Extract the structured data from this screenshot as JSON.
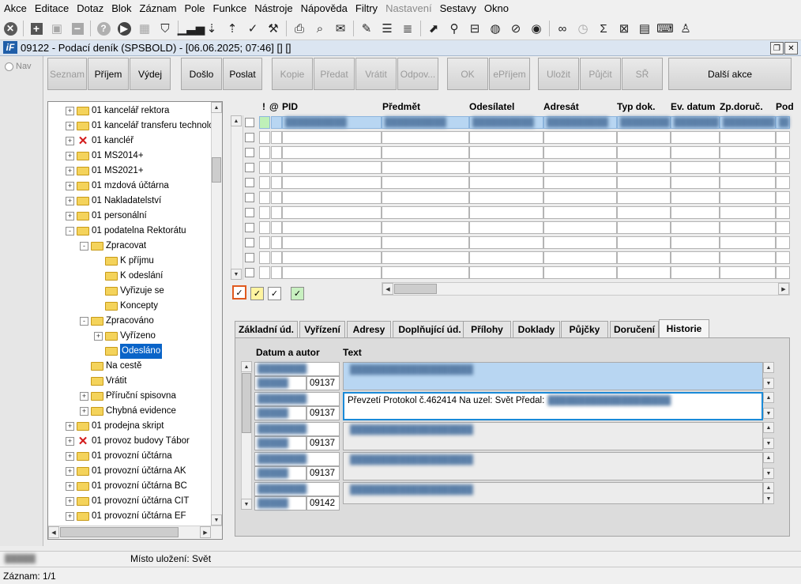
{
  "menu": [
    "Akce",
    "Editace",
    "Dotaz",
    "Blok",
    "Záznam",
    "Pole",
    "Funkce",
    "Nástroje",
    "Nápověda",
    "Filtry",
    "Nastavení",
    "Sestavy",
    "Okno"
  ],
  "menu_disabled_index": 10,
  "window": {
    "logo": "iF",
    "title": "09122 - Podací deník (SPSBOLD) - [06.06.2025; 07:46] [] []"
  },
  "nav": {
    "label": "Nav"
  },
  "actions": {
    "seznam": "Seznam",
    "prijem": "Příjem",
    "vydej": "Výdej",
    "doslo": "Došlo",
    "poslat": "Poslat",
    "kopie": "Kopie",
    "predat": "Předat",
    "vratit": "Vrátit",
    "odpov": "Odpov...",
    "ok": "OK",
    "eprijem": "ePříjem",
    "ulozit": "Uložit",
    "pujcit": "Půjčit",
    "sr": "SŘ",
    "dalsi": "Další akce"
  },
  "tree": [
    {
      "label": "01 kancelář rektora",
      "icon": "folder",
      "exp": "+"
    },
    {
      "label": "01 kancelář transferu technologií",
      "icon": "folder",
      "exp": "+"
    },
    {
      "label": "01 kancléř",
      "icon": "x",
      "exp": "+"
    },
    {
      "label": "01 MS2014+",
      "icon": "folder",
      "exp": "+"
    },
    {
      "label": "01 MS2021+",
      "icon": "folder",
      "exp": "+"
    },
    {
      "label": "01 mzdová účtárna",
      "icon": "folder",
      "exp": "+"
    },
    {
      "label": "01 Nakladatelství",
      "icon": "folder",
      "exp": "+"
    },
    {
      "label": "01 personální",
      "icon": "folder",
      "exp": "+"
    },
    {
      "label": "01 podatelna Rektorátu",
      "icon": "folder",
      "exp": "-"
    },
    {
      "label": "Zpracovat",
      "icon": "folder",
      "exp": "-"
    },
    {
      "label": "K příjmu",
      "icon": "folder",
      "exp": ""
    },
    {
      "label": "K odeslání",
      "icon": "folder",
      "exp": ""
    },
    {
      "label": "Vyřizuje se",
      "icon": "folder",
      "exp": ""
    },
    {
      "label": "Koncepty",
      "icon": "folder",
      "exp": ""
    },
    {
      "label": "Zpracováno",
      "icon": "folder",
      "exp": "-"
    },
    {
      "label": "Vyřízeno",
      "icon": "folder",
      "exp": "+"
    },
    {
      "label": "Odesláno",
      "icon": "folder",
      "exp": ""
    },
    {
      "label": "Na cestě",
      "icon": "folder",
      "exp": ""
    },
    {
      "label": "Vrátit",
      "icon": "folder",
      "exp": ""
    },
    {
      "label": "Příruční spisovna",
      "icon": "folder",
      "exp": "+"
    },
    {
      "label": "Chybná evidence",
      "icon": "folder",
      "exp": "+"
    },
    {
      "label": "01 prodejna skript",
      "icon": "folder",
      "exp": "+"
    },
    {
      "label": "01 provoz budovy Tábor",
      "icon": "x",
      "exp": "+"
    },
    {
      "label": "01 provozní účtárna",
      "icon": "folder",
      "exp": "+"
    },
    {
      "label": "01 provozní účtárna AK",
      "icon": "folder",
      "exp": "+"
    },
    {
      "label": "01 provozní účtárna BC",
      "icon": "folder",
      "exp": "+"
    },
    {
      "label": "01 provozní účtárna CIT",
      "icon": "folder",
      "exp": "+"
    },
    {
      "label": "01 provozní účtárna EF",
      "icon": "folder",
      "exp": "+"
    }
  ],
  "grid": {
    "headers": {
      "flag": "!",
      "att": "@",
      "pid": "PID",
      "predmet": "Předmět",
      "odesilatel": "Odesílatel",
      "adresat": "Adresát",
      "typ": "Typ dok.",
      "evdatum": "Ev. datum",
      "zpdoruc": "Zp.doruč.",
      "pod": "Pod"
    }
  },
  "tabs": [
    "Základní úd.",
    "Vyřízení",
    "Adresy",
    "Doplňující úd.",
    "Přílohy",
    "Doklady",
    "Půjčky",
    "Doručení",
    "Historie"
  ],
  "history": {
    "col_date": "Datum a autor",
    "col_text": "Text",
    "rows": [
      {
        "id": "09137",
        "text": ""
      },
      {
        "id": "09137",
        "text": "Převzetí Protokol č.462414 Na uzel: Svět Předal:"
      },
      {
        "id": "09137",
        "text": ""
      },
      {
        "id": "09137",
        "text": ""
      },
      {
        "id": "09142",
        "text": ""
      }
    ]
  },
  "status": {
    "location": "Místo uložení: Svět",
    "record": "Záznam: 1/1"
  },
  "colors": {
    "selection": "#0a64c8",
    "row_selected": "#b8d6f2",
    "focus": "#1a8ad8",
    "folder": "#f4d35b"
  }
}
